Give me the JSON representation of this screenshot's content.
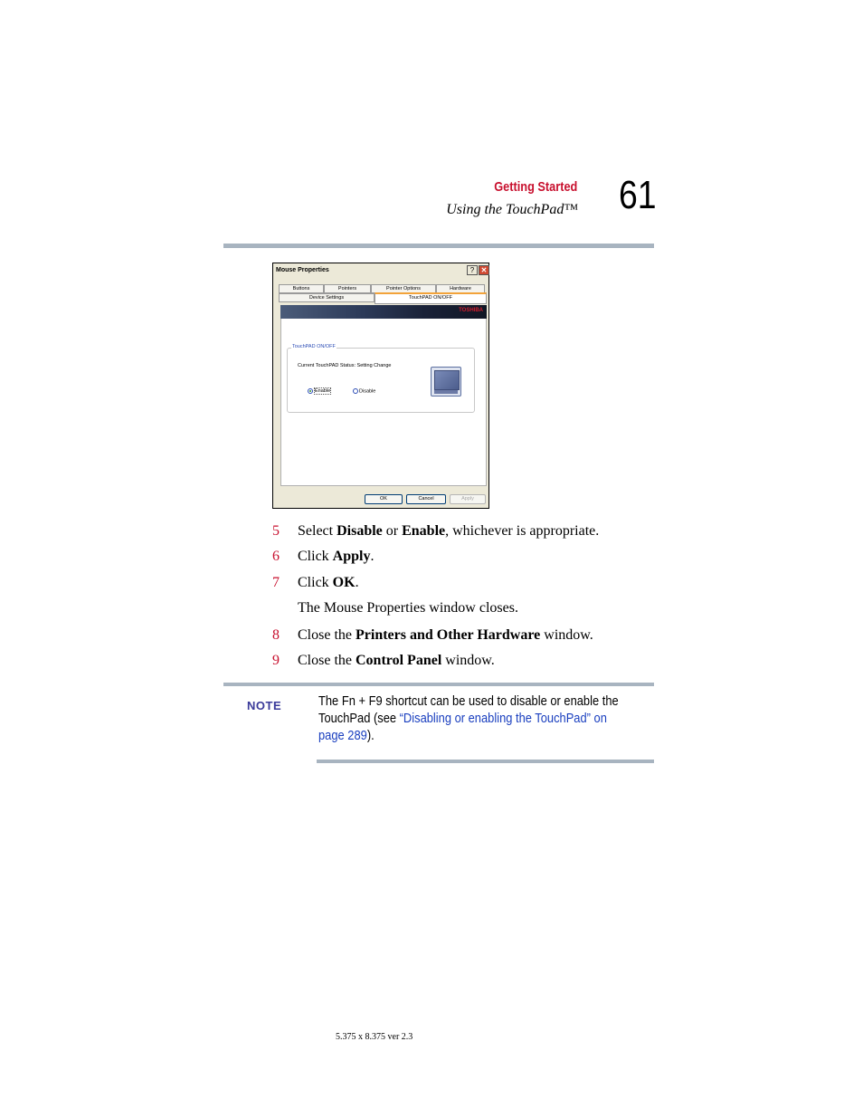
{
  "header": {
    "section": "Getting Started",
    "subsection": "Using the TouchPad™",
    "page_number": "61"
  },
  "dialog": {
    "title": "Mouse Properties",
    "help_label": "?",
    "close_label": "✕",
    "tabs_row1": [
      "Buttons",
      "Pointers",
      "Pointer Options",
      "Hardware"
    ],
    "tabs_row2": [
      "Device Settings",
      "TouchPAD ON/OFF"
    ],
    "brand": "TOSHIBA",
    "group_label": "TouchPAD ON/OFF",
    "status_text": "Current TouchPAD Status: Setting Change",
    "radio_enable": "Enable",
    "radio_disable": "Disable",
    "ok": "OK",
    "cancel": "Cancel",
    "apply": "Apply"
  },
  "steps": [
    {
      "num": "5",
      "pre": "Select ",
      "b1": "Disable",
      "mid": " or ",
      "b2": "Enable",
      "post": ", whichever is appropriate."
    },
    {
      "num": "6",
      "pre": "Click ",
      "b1": "Apply",
      "post": "."
    },
    {
      "num": "7",
      "pre": "Click ",
      "b1": "OK",
      "post": "."
    },
    {
      "num": "8",
      "pre": "Close the ",
      "b1": "Printers and Other Hardware",
      "post": " window."
    },
    {
      "num": "9",
      "pre": "Close the ",
      "b1": "Control Panel",
      "post": " window."
    }
  ],
  "step7_result": "The Mouse Properties window closes.",
  "note": {
    "label": "NOTE",
    "text_before": "The Fn + F9 shortcut can be used to disable or enable the TouchPad (see ",
    "link": "“Disabling or enabling the TouchPad” on page 289",
    "text_after": ")."
  },
  "footer": "5.375 x 8.375 ver 2.3",
  "colors": {
    "accent": "#c8102e",
    "rule": "#a8b4c0",
    "link": "#1a3fbf",
    "note_label": "#3a3a9a"
  }
}
